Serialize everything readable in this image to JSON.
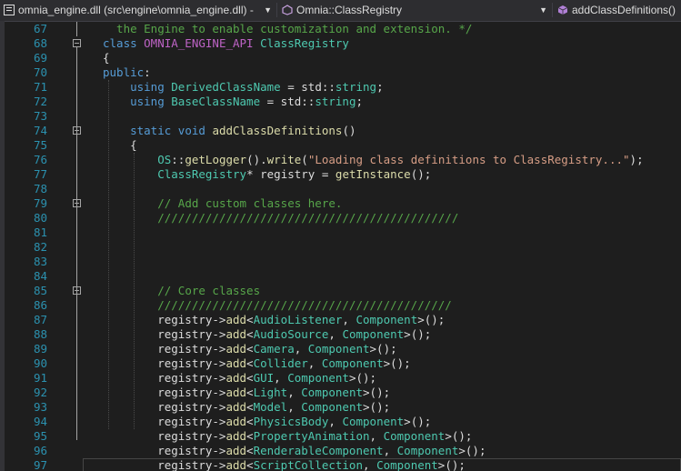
{
  "navigation_bar": {
    "project_dropdown": "omnia_engine.dll (src\\engine\\omnia_engine.dll) -",
    "scope_dropdown": "Omnia::ClassRegistry",
    "member_dropdown": "addClassDefinitions()",
    "icons": [
      "cpp-project-icon",
      "class-icon",
      "method-icon",
      "dropdown-arrow-icon"
    ]
  },
  "colors": {
    "keyword": "#569cd6",
    "type": "#4ec9b0",
    "function": "#dcdcaa",
    "string": "#d69d85",
    "comment": "#57a64a",
    "macro": "#bd63c5",
    "line_number": "#2b91af",
    "background": "#1e1e1e"
  },
  "editor": {
    "lines": [
      {
        "n": "67",
        "tokens": [
          [
            "cm",
            "  the Engine to enable customization and extension. */"
          ]
        ]
      },
      {
        "n": "68",
        "tokens": [
          [
            "kw",
            "class "
          ],
          [
            "mac",
            "OMNIA_ENGINE_API "
          ],
          [
            "cls",
            "ClassRegistry"
          ]
        ]
      },
      {
        "n": "69",
        "tokens": [
          [
            "pl",
            "{"
          ]
        ]
      },
      {
        "n": "70",
        "tokens": [
          [
            "kw",
            "public"
          ],
          [
            "pl",
            ":"
          ]
        ]
      },
      {
        "n": "71",
        "tokens": [
          [
            "pl",
            "    "
          ],
          [
            "kw",
            "using "
          ],
          [
            "ty",
            "DerivedClassName"
          ],
          [
            "pl",
            " = std::"
          ],
          [
            "ty",
            "string"
          ],
          [
            "pl",
            ";"
          ]
        ]
      },
      {
        "n": "72",
        "tokens": [
          [
            "pl",
            "    "
          ],
          [
            "kw",
            "using "
          ],
          [
            "ty",
            "BaseClassName"
          ],
          [
            "pl",
            " = std::"
          ],
          [
            "ty",
            "string"
          ],
          [
            "pl",
            ";"
          ]
        ]
      },
      {
        "n": "73",
        "tokens": []
      },
      {
        "n": "74",
        "tokens": [
          [
            "pl",
            "    "
          ],
          [
            "kw",
            "static "
          ],
          [
            "kw",
            "void "
          ],
          [
            "fn",
            "addClassDefinitions"
          ],
          [
            "pl",
            "()"
          ]
        ]
      },
      {
        "n": "75",
        "tokens": [
          [
            "pl",
            "    {"
          ]
        ]
      },
      {
        "n": "76",
        "tokens": [
          [
            "pl",
            "        "
          ],
          [
            "ty",
            "OS"
          ],
          [
            "pl",
            "::"
          ],
          [
            "fn",
            "getLogger"
          ],
          [
            "pl",
            "()."
          ],
          [
            "fn",
            "write"
          ],
          [
            "pl",
            "("
          ],
          [
            "str",
            "\"Loading class definitions to ClassRegistry...\""
          ],
          [
            "pl",
            ");"
          ]
        ]
      },
      {
        "n": "77",
        "tokens": [
          [
            "pl",
            "        "
          ],
          [
            "cls",
            "ClassRegistry"
          ],
          [
            "pl",
            "* "
          ],
          [
            "pl",
            "registry = "
          ],
          [
            "fn",
            "getInstance"
          ],
          [
            "pl",
            "();"
          ]
        ]
      },
      {
        "n": "78",
        "tokens": []
      },
      {
        "n": "79",
        "tokens": [
          [
            "pl",
            "        "
          ],
          [
            "cm",
            "// Add custom classes here."
          ]
        ]
      },
      {
        "n": "80",
        "tokens": [
          [
            "pl",
            "        "
          ],
          [
            "cm",
            "////////////////////////////////////////////"
          ]
        ]
      },
      {
        "n": "81",
        "tokens": []
      },
      {
        "n": "82",
        "tokens": []
      },
      {
        "n": "83",
        "tokens": []
      },
      {
        "n": "84",
        "tokens": []
      },
      {
        "n": "85",
        "tokens": [
          [
            "pl",
            "        "
          ],
          [
            "cm",
            "// Core classes"
          ]
        ]
      },
      {
        "n": "86",
        "tokens": [
          [
            "pl",
            "        "
          ],
          [
            "cm",
            "///////////////////////////////////////////"
          ]
        ]
      },
      {
        "n": "87",
        "tokens": [
          [
            "pl",
            "        registry->"
          ],
          [
            "fn",
            "add"
          ],
          [
            "pl",
            "<"
          ],
          [
            "cls",
            "AudioListener"
          ],
          [
            "pl",
            ", "
          ],
          [
            "cls",
            "Component"
          ],
          [
            "pl",
            ">();"
          ]
        ]
      },
      {
        "n": "88",
        "tokens": [
          [
            "pl",
            "        registry->"
          ],
          [
            "fn",
            "add"
          ],
          [
            "pl",
            "<"
          ],
          [
            "cls",
            "AudioSource"
          ],
          [
            "pl",
            ", "
          ],
          [
            "cls",
            "Component"
          ],
          [
            "pl",
            ">();"
          ]
        ]
      },
      {
        "n": "89",
        "tokens": [
          [
            "pl",
            "        registry->"
          ],
          [
            "fn",
            "add"
          ],
          [
            "pl",
            "<"
          ],
          [
            "cls",
            "Camera"
          ],
          [
            "pl",
            ", "
          ],
          [
            "cls",
            "Component"
          ],
          [
            "pl",
            ">();"
          ]
        ]
      },
      {
        "n": "90",
        "tokens": [
          [
            "pl",
            "        registry->"
          ],
          [
            "fn",
            "add"
          ],
          [
            "pl",
            "<"
          ],
          [
            "cls",
            "Collider"
          ],
          [
            "pl",
            ", "
          ],
          [
            "cls",
            "Component"
          ],
          [
            "pl",
            ">();"
          ]
        ]
      },
      {
        "n": "91",
        "tokens": [
          [
            "pl",
            "        registry->"
          ],
          [
            "fn",
            "add"
          ],
          [
            "pl",
            "<"
          ],
          [
            "cls",
            "GUI"
          ],
          [
            "pl",
            ", "
          ],
          [
            "cls",
            "Component"
          ],
          [
            "pl",
            ">();"
          ]
        ]
      },
      {
        "n": "92",
        "tokens": [
          [
            "pl",
            "        registry->"
          ],
          [
            "fn",
            "add"
          ],
          [
            "pl",
            "<"
          ],
          [
            "cls",
            "Light"
          ],
          [
            "pl",
            ", "
          ],
          [
            "cls",
            "Component"
          ],
          [
            "pl",
            ">();"
          ]
        ]
      },
      {
        "n": "93",
        "tokens": [
          [
            "pl",
            "        registry->"
          ],
          [
            "fn",
            "add"
          ],
          [
            "pl",
            "<"
          ],
          [
            "cls",
            "Model"
          ],
          [
            "pl",
            ", "
          ],
          [
            "cls",
            "Component"
          ],
          [
            "pl",
            ">();"
          ]
        ]
      },
      {
        "n": "94",
        "tokens": [
          [
            "pl",
            "        registry->"
          ],
          [
            "fn",
            "add"
          ],
          [
            "pl",
            "<"
          ],
          [
            "cls",
            "PhysicsBody"
          ],
          [
            "pl",
            ", "
          ],
          [
            "cls",
            "Component"
          ],
          [
            "pl",
            ">();"
          ]
        ]
      },
      {
        "n": "95",
        "tokens": [
          [
            "pl",
            "        registry->"
          ],
          [
            "fn",
            "add"
          ],
          [
            "pl",
            "<"
          ],
          [
            "cls",
            "PropertyAnimation"
          ],
          [
            "pl",
            ", "
          ],
          [
            "cls",
            "Component"
          ],
          [
            "pl",
            ">();"
          ]
        ]
      },
      {
        "n": "96",
        "tokens": [
          [
            "pl",
            "        registry->"
          ],
          [
            "fn",
            "add"
          ],
          [
            "pl",
            "<"
          ],
          [
            "cls",
            "RenderableComponent"
          ],
          [
            "pl",
            ", "
          ],
          [
            "cls",
            "Component"
          ],
          [
            "pl",
            ">();"
          ]
        ]
      },
      {
        "n": "97",
        "tokens": [
          [
            "pl",
            "        registry->"
          ],
          [
            "fn",
            "add"
          ],
          [
            "pl",
            "<"
          ],
          [
            "cls",
            "ScriptCollection"
          ],
          [
            "pl",
            ", "
          ],
          [
            "cls",
            "Component"
          ],
          [
            "pl",
            ">();"
          ]
        ]
      }
    ]
  }
}
